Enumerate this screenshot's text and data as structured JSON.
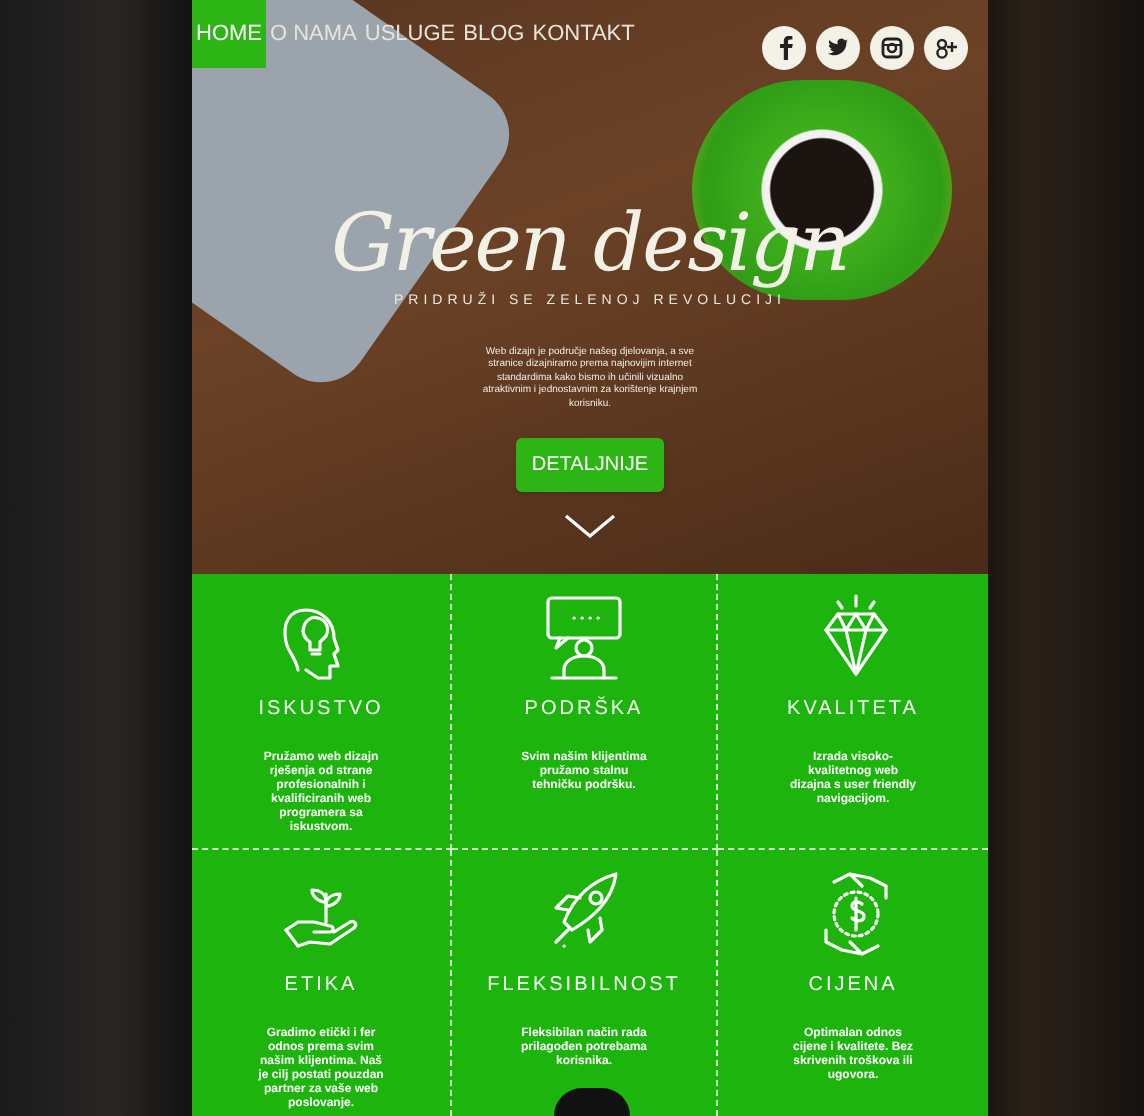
{
  "nav": {
    "items": [
      {
        "label": "HOME",
        "selected": true
      },
      {
        "label": "O NAMA",
        "selected": false
      },
      {
        "label": "USLUGE",
        "selected": false
      },
      {
        "label": "BLOG",
        "selected": false
      },
      {
        "label": "KONTAKT",
        "selected": false
      }
    ],
    "social": [
      {
        "kind": "facebook"
      },
      {
        "kind": "twitter"
      },
      {
        "kind": "instagram"
      },
      {
        "kind": "googleplus"
      }
    ]
  },
  "hero": {
    "title": "Green design",
    "subtitle": "PRIDRUŽI SE ZELENOJ REVOLUCIJI",
    "text": "Web dizajn je područje našeg djelovanja, a sve stranice dizajniramo prema najnovijim internet standardima kako bismo ih učinili vizualno atraktivnim i jednostavnim za korištenje krajnjem korisniku.",
    "button": "DETALJNIJE"
  },
  "features": [
    {
      "kind": "head",
      "title": "ISKUSTVO",
      "text": "Pružamo web dizajn rješenja od strane profesionalnih i kvalificiranih web programera sa iskustvom."
    },
    {
      "kind": "support",
      "title": "PODRŠKA",
      "text": "Svim našim klijentima pružamo stalnu tehničku podršku."
    },
    {
      "kind": "diamond",
      "title": "KVALITETA",
      "text": "Izrada visoko-kvalitetnog web dizajna s user friendly navigacijom."
    },
    {
      "kind": "plant",
      "title": "ETIKA",
      "text": "Gradimo etički i fer odnos prema svim našim klijentima. Naš je cilj postati pouzdan partner za vaše web poslovanje."
    },
    {
      "kind": "rocket",
      "title": "FLEKSIBILNOST",
      "text": "Fleksibilan način rada prilagođen potrebama korisnika."
    },
    {
      "kind": "money",
      "title": "CIJENA",
      "text": "Optimalan odnos cijene i kvalitete. Bez skrivenih troškova ili ugovora."
    }
  ]
}
